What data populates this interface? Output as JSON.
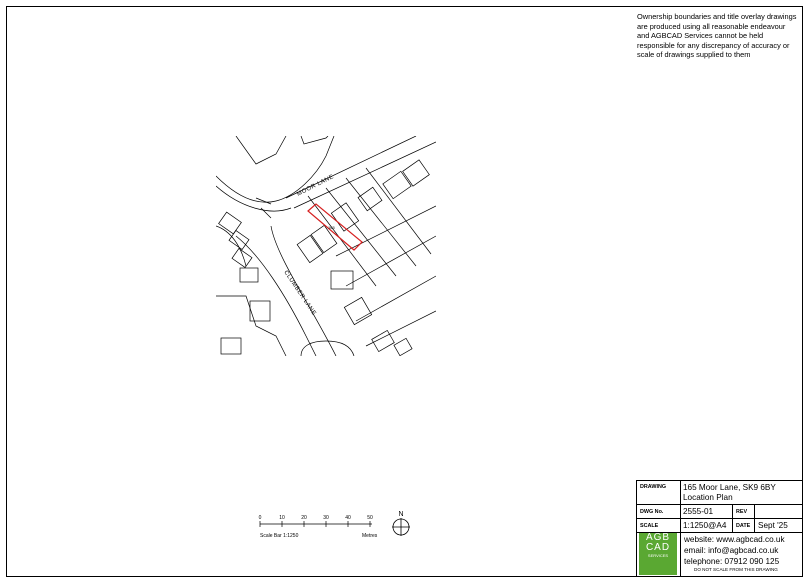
{
  "disclaimer": "Ownership boundaries and title overlay drawings are produced using all reasonable endeavour and AGBCAD Services cannot be held responsible for any discrepancy of accuracy or scale of drawings supplied to them",
  "map": {
    "road_moor": "MOOR LANE",
    "road_clumber": "CLUMBER LANE",
    "plot_number": "165",
    "boundary_color": "#d62020"
  },
  "scalebar": {
    "ticks": [
      "0",
      "10",
      "20",
      "30",
      "40",
      "50"
    ],
    "caption": "Scale Bar 1:1250",
    "units": "Metres"
  },
  "north": {
    "label": "N"
  },
  "title_block": {
    "drawing_label": "DRAWING",
    "drawing_line1": "165 Moor Lane, SK9 6BY",
    "drawing_line2": "Location Plan",
    "dwg_label": "DWG No.",
    "dwg_value": "2555-01",
    "rev_label": "REV",
    "rev_value": "",
    "scale_label": "SCALE",
    "scale_value": "1:1250@A4",
    "date_label": "DATE",
    "date_value": "Sept '25",
    "website": "website: www.agbcad.co.uk",
    "email": "email: info@agbcad.co.uk",
    "telephone": "telephone: 07912 090 125",
    "dns": "DO NOT SCALE FROM THIS DRAWING",
    "logo_lines": [
      "AGB",
      "CAD",
      "SERVICES"
    ],
    "logo_color": "#5aa832"
  }
}
